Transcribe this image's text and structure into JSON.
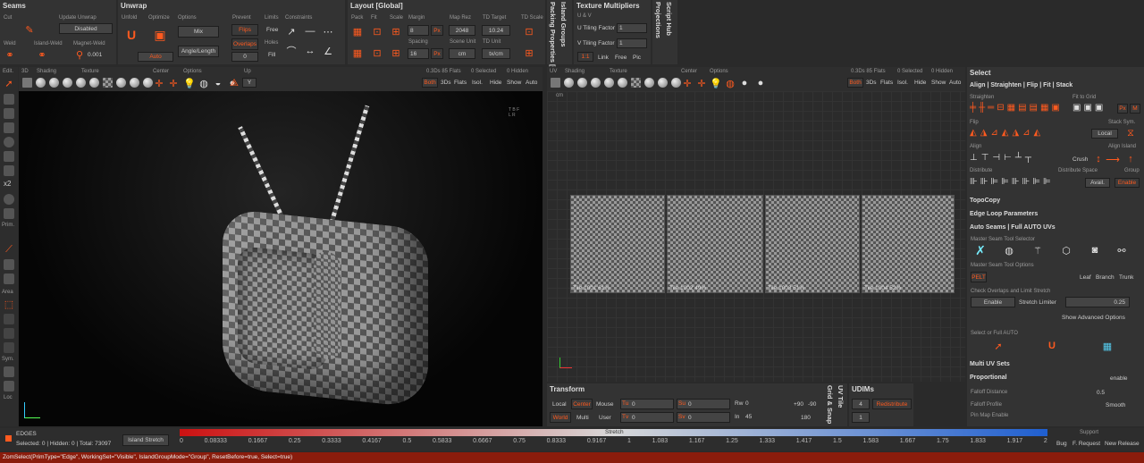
{
  "seams": {
    "title": "Seams",
    "cut": "Cut",
    "update_unwrap": "Update Unwrap",
    "disabled": "Disabled",
    "weld": "Weld",
    "island_weld": "Island-Weld",
    "magnet_weld": "Magnet-Weld",
    "magnet_val": "0.001"
  },
  "unwrap": {
    "title": "Unwrap",
    "unfold": "Unfold",
    "optimize": "Optimize",
    "options": "Options",
    "mix": "Mix",
    "angle_length": "Angle/Length",
    "auto": "Auto",
    "prevent": "Prevent",
    "flips": "Flips",
    "overlaps": "Overlaps",
    "limits": "Limits",
    "free": "Free",
    "holes": "Holes",
    "fill": "Fill",
    "constraints": "Constraints",
    "zero": "0"
  },
  "layout": {
    "title": "Layout [Global]",
    "pack": "Pack",
    "fit": "Fit",
    "scale": "Scale",
    "margin": "Margin",
    "margin_val": "8",
    "px": "Px",
    "map_rez": "Map Rez",
    "map_rez_val": "2048",
    "td_target": "TD Target",
    "td_target_val": "10.24",
    "td_scale": "TD Scale",
    "spacing": "Spacing",
    "spacing_val": "16",
    "scene_unit": "Scene Unit",
    "cm": "cm",
    "td_unit": "TD Unit",
    "txcm": "tx/cm"
  },
  "packing": {
    "tab1": "Packing Properties [G",
    "tab2": "Island Groups"
  },
  "texmult": {
    "title": "Texture Multipliers",
    "uv": "U & V",
    "u_label": "U Tiling Factor",
    "u_val": "1",
    "v_label": "V Tiling Factor",
    "v_val": "1",
    "ratio": "1:1",
    "link": "Link",
    "free": "Free",
    "pic": "Pic"
  },
  "side_tabs": {
    "projections": "Projections",
    "script_hub": "Script Hub"
  },
  "tools": {
    "edit": "Edit.",
    "prim": "Prim.",
    "area": "Area",
    "sym": "Sym.",
    "loc": "Loc",
    "x2": "x2"
  },
  "vp3d": {
    "title": "3D",
    "shading": "Shading",
    "texture": "Texture",
    "center": "Center",
    "options": "Options",
    "up": "Up",
    "up_val": "Y",
    "stats": "0.3Ds 85 Flats",
    "selected": "0 Selected",
    "hidden": "0 Hidden",
    "both": "Both",
    "ds3": "3Ds",
    "flats": "Flats",
    "isol": "Isol.",
    "hide": "Hide",
    "show": "Show",
    "auto": "Auto"
  },
  "vpuv": {
    "title": "UV",
    "shading": "Shading",
    "texture": "Texture",
    "center": "Center",
    "options": "Options",
    "stats": "0.3Ds 85 Flats",
    "selected": "0 Selected",
    "hidden": "0 Hidden",
    "both": "Both",
    "ds3": "3Ds",
    "flats": "Flats",
    "isol": "Isol.",
    "hide": "Hide",
    "show": "Show",
    "auto": "Auto",
    "cm": "cm",
    "tiles": [
      "Tile 1001 61%",
      "Tile 1002 49%",
      "Tile 1003 51%",
      "Tile 1004 52%"
    ]
  },
  "right": {
    "select": "Select",
    "align_header": "Align | Straighten | Flip | Fit | Stack",
    "straighten": "Straighten",
    "fit_to_grid": "Fit to Grid",
    "px": "Px",
    "m": "M",
    "flip": "Flip",
    "stack_sym": "Stack Sym.",
    "local": "Local",
    "align": "Align",
    "align_island": "Align Island",
    "crush": "Crush",
    "distribute": "Distribute",
    "distribute_space": "Distribute Space",
    "group": "Group",
    "avail": "Avail.",
    "enable": "Enable",
    "topocopy": "TopoCopy",
    "edge_loop": "Edge Loop Parameters",
    "auto_seams": "Auto Seams | Full AUTO UVs",
    "master_selector": "Master Seam Tool Selector",
    "master_options": "Master Seam Tool Options",
    "pelt": "PELT",
    "leaf": "Leaf",
    "branch": "Branch",
    "trunk": "Trunk",
    "check_overlaps": "Check Overlaps and Limit Stretch",
    "enable2": "Enable",
    "stretch_limiter": "Stretch Limiter",
    "stretch_val": "0.25",
    "show_adv": "Show Advanced Options",
    "select_full": "Select or Full AUTO",
    "multi_uv": "Multi UV Sets",
    "proportional": "Proportional",
    "enable_small": "enable",
    "falloff_distance": "Falloff Distance",
    "falloff_val": "0.5",
    "falloff_profile": "Falloff Profile",
    "smooth": "Smooth",
    "pin_map": "Pin Map Enable"
  },
  "transform": {
    "title": "Transform",
    "local": "Local",
    "center": "Center",
    "mouse": "Mouse",
    "world": "World",
    "multi": "Multi",
    "user": "User",
    "tu": "Tu",
    "tv": "Tv",
    "su": "Su",
    "sv": "Sv",
    "zero": "0",
    "rw": "Rw",
    "rw_val": "0",
    "in": "In",
    "in_val": "45",
    "p90": "+90",
    "m90": "-90",
    "v180": "180",
    "grid_snap": "Grid & Snap",
    "uv_tile": "UV Tile"
  },
  "udims": {
    "title": "UDIMs",
    "val4": "4",
    "redistribute": "Redistribute",
    "val1": "1",
    "q": "?"
  },
  "status": {
    "mode": "EDGES",
    "counts": "Selected: 0 | Hidden: 0 | Total: 73097",
    "metric": "Island Stretch",
    "stretch": "Stretch",
    "ticks": [
      "0",
      "0.08333",
      "0.1667",
      "0.25",
      "0.3333",
      "0.4167",
      "0.5",
      "0.5833",
      "0.6667",
      "0.75",
      "0.8333",
      "0.9167",
      "1",
      "1.083",
      "1.167",
      "1.25",
      "1.333",
      "1.417",
      "1.5",
      "1.583",
      "1.667",
      "1.75",
      "1.833",
      "1.917",
      "2"
    ],
    "support": "Support",
    "bug": "Bug",
    "f_request": "F. Request",
    "new_release": "New Release"
  },
  "command": "ZomSelect(PrimType=\"Edge\", WorkingSet=\"Visible\", IslandGroupMode=\"Group\", ResetBefore=true, Select=true)",
  "colors": {
    "accent": "#ff5a1f",
    "bg": "#2a2a2a",
    "panel": "#333333",
    "stretch_start": "#cc1111",
    "stretch_end": "#1f5fd0"
  }
}
